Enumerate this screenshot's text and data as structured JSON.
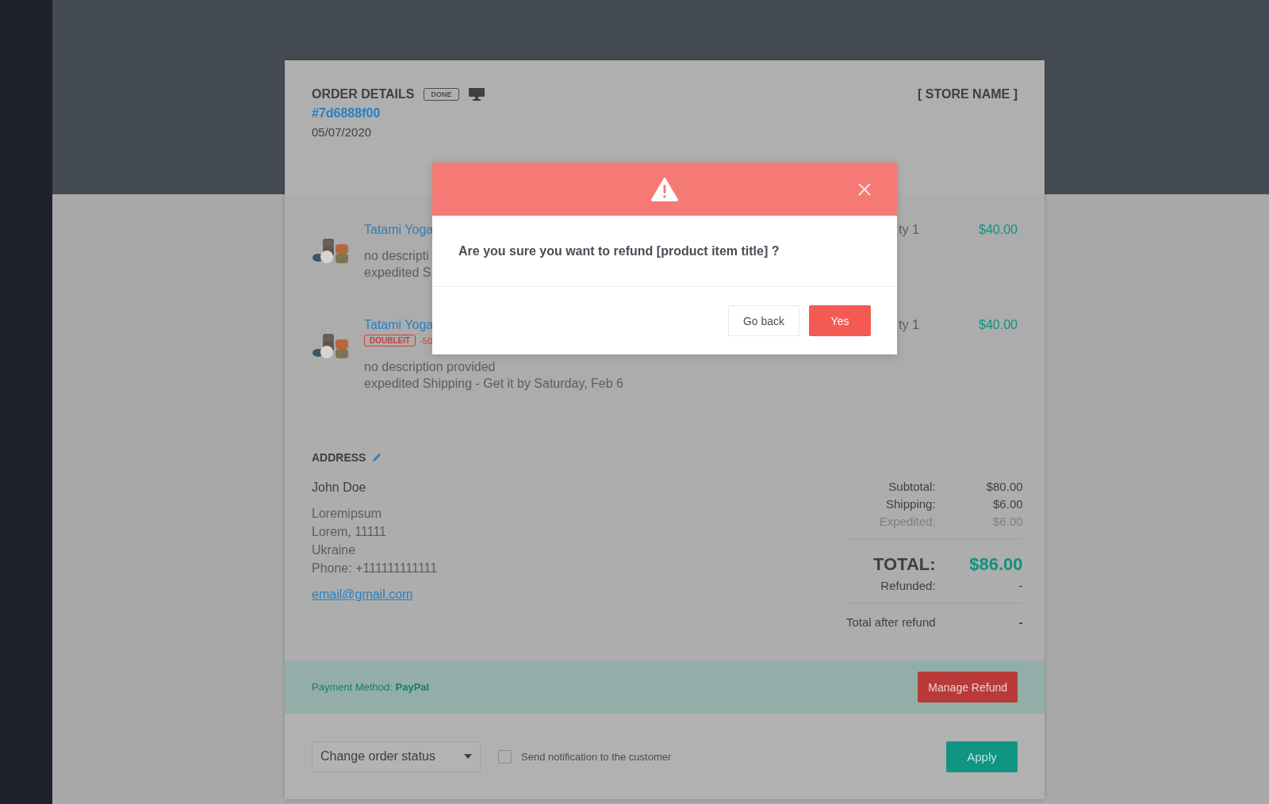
{
  "order": {
    "title": "ORDER DETAILS",
    "status_badge": "DONE",
    "order_id": "#7d6888f00",
    "date": "05/07/2020",
    "store_name": "[ STORE NAME ]"
  },
  "items": [
    {
      "title": "Tatami Yoga",
      "description": "no descripti",
      "shipping": "expedited S",
      "quantity": "ty 1",
      "price": "$40.00"
    },
    {
      "title": "Tatami Yoga",
      "badge": "DOUBLEIT",
      "discount": "-50",
      "description": "no description provided",
      "shipping": "expedited Shipping - Get it by Saturday, Feb 6",
      "quantity": "ty 1",
      "price": "$40.00"
    }
  ],
  "address": {
    "heading": "ADDRESS",
    "name": "John Doe",
    "lines": [
      "Loremipsum",
      "Lorem, 11111",
      "Ukraine",
      "Phone: +111111111111"
    ],
    "email": "email@gmail.com"
  },
  "totals": [
    {
      "kind": "line",
      "label": "Subtotal:",
      "value": "$80.00"
    },
    {
      "kind": "line",
      "label": "Shipping:",
      "value": "$6.00"
    },
    {
      "kind": "muted",
      "label": "Expedited:",
      "value": "$6.00"
    },
    {
      "kind": "total",
      "label": "TOTAL:",
      "value": "$86.00"
    },
    {
      "kind": "line",
      "label": "Refunded:",
      "value": "-"
    },
    {
      "kind": "after",
      "label": "Total after refund",
      "value": "-"
    }
  ],
  "payment": {
    "text": "Payment Method: **PayPal**",
    "button": "Manage Refund"
  },
  "footer": {
    "status_select": "Change order status",
    "notify": {
      "label": "Send notification to the customer",
      "checked": false
    },
    "apply": "Apply"
  },
  "dialog": {
    "message": "Are you sure you want to refund [product item title] ?",
    "buttons": [
      {
        "label": "Go back",
        "kind": "secondary"
      },
      {
        "label": "Yes",
        "kind": "primary"
      }
    ]
  }
}
